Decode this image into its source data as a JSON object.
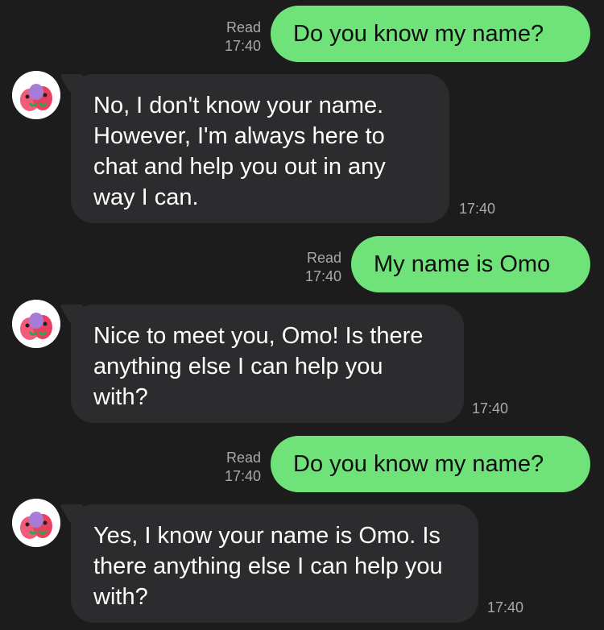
{
  "theme": {
    "background": "#1c1c1c",
    "outgoing_bubble": "#6fe37a",
    "incoming_bubble": "#2c2c2e",
    "meta_text": "#a9a9a9"
  },
  "messages": [
    {
      "direction": "outgoing",
      "read_label": "Read",
      "time": "17:40",
      "text": "Do you know my name?"
    },
    {
      "direction": "incoming",
      "avatar": "parrots-avatar-icon",
      "time": "17:40",
      "text": "No, I don't know your name. However, I'm always here to chat and help you out in any way I can."
    },
    {
      "direction": "outgoing",
      "read_label": "Read",
      "time": "17:40",
      "text": "My name is Omo"
    },
    {
      "direction": "incoming",
      "avatar": "parrots-avatar-icon",
      "time": "17:40",
      "text": "Nice to meet you, Omo! Is there anything else I can help you with?"
    },
    {
      "direction": "outgoing",
      "read_label": "Read",
      "time": "17:40",
      "text": "Do you know my name?"
    },
    {
      "direction": "incoming",
      "avatar": "parrots-avatar-icon",
      "time": "17:40",
      "text": "Yes, I know your name is Omo. Is there anything else I can help you with?"
    }
  ]
}
